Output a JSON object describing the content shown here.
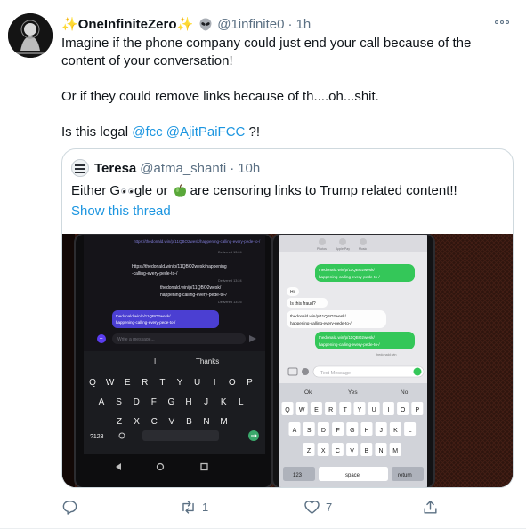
{
  "tweet": {
    "display_name": "OneInfiniteZero",
    "sparkle": "✨",
    "handle": "@1infinite0",
    "separator": "·",
    "time": "1h",
    "text_lines": [
      "Imagine if the phone company could just end your call because of the",
      "content of your conversation!",
      "Or if they could remove links because of th....oh...shit.",
      "Is this legal "
    ],
    "mentions": [
      "@fcc",
      "@AjitPaiFCC"
    ],
    "text_end": " ?!"
  },
  "quote": {
    "display_name": "Teresa",
    "handle": "@atma_shanti",
    "separator": "·",
    "time": "10h",
    "text_part1": "Either G",
    "text_part2": "gle or",
    "text_part3": "are censoring links to Trump related content!!",
    "show_thread": "Show this thread",
    "media": {
      "left_phone": {
        "url_line": "https://thedonald.win/p/11QBO2wesk/happening-calling-every-pede-to-/",
        "bubble": "thedonald.win/p/11QBO2wesk/happening-calling-every-pede-to-/",
        "input_placeholder": "Write a message...",
        "suggestions": [
          "I",
          "Thanks"
        ],
        "keys_row1": [
          "Q",
          "W",
          "E",
          "R",
          "T",
          "Y",
          "U",
          "I",
          "O",
          "P"
        ],
        "keys_row2": [
          "A",
          "S",
          "D",
          "F",
          "G",
          "H",
          "J",
          "K",
          "L"
        ],
        "keys_row3": [
          "Z",
          "X",
          "C",
          "V",
          "B",
          "N",
          "M"
        ],
        "key_numbers": "?123",
        "timestamps": [
          "Delivered 13:24",
          "Delivered 13:24",
          "Delivered 13:25"
        ]
      },
      "right_phone": {
        "header_labels": [
          "Photos",
          "Apple Pay",
          "Music"
        ],
        "bubble_1": "thedonald.win/p/11QBO2wesk/happening-calling-every-pede-to-/",
        "incoming_1": "Hi",
        "incoming_2": "Is this fraud?",
        "incoming_3": "thedonald.win/p/11QBO2wesk/happening-calling-every-pede-to-/",
        "bubble_2": "thedonald.win/p/11QBO2wesk/happening-calling-every-pede-to-/",
        "bubble_2_sub": "thedonald.win",
        "input_placeholder": "Text Message",
        "suggestions": [
          "Ok",
          "Yes",
          "No"
        ],
        "keys_row1": [
          "Q",
          "W",
          "E",
          "R",
          "T",
          "Y",
          "U",
          "I",
          "O",
          "P"
        ],
        "keys_row2": [
          "A",
          "S",
          "D",
          "F",
          "G",
          "H",
          "J",
          "K",
          "L"
        ],
        "keys_row3": [
          "Z",
          "X",
          "C",
          "V",
          "B",
          "N",
          "M"
        ],
        "key_numbers": "123",
        "key_space": "space",
        "key_return": "return"
      }
    }
  },
  "actions": {
    "reply_count": "",
    "retweet_count": "1",
    "like_count": "7"
  },
  "colors": {
    "accent": "#1b95e0",
    "muted": "#5b7083",
    "imessage_green": "#34c759",
    "dark_app_purple": "#5b3df0"
  },
  "icons": [
    "alien-icon",
    "more-icon",
    "reply-icon",
    "retweet-icon",
    "like-icon",
    "share-icon"
  ]
}
